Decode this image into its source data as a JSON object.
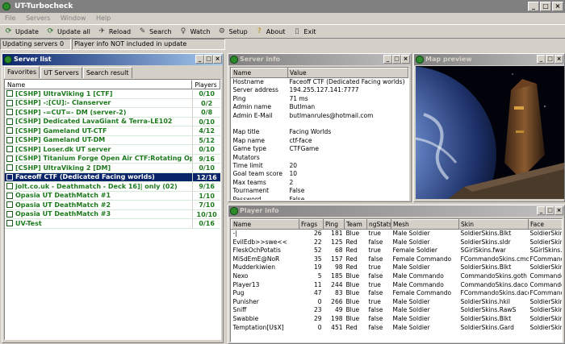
{
  "window": {
    "title": "UT-Turbocheck"
  },
  "menu": [
    "File",
    "Servers",
    "Window",
    "Help"
  ],
  "toolbar": [
    {
      "label": "Update",
      "icon": "update-icon"
    },
    {
      "label": "Update all",
      "icon": "update-all-icon"
    },
    {
      "label": "Reload",
      "icon": "reload-icon"
    },
    {
      "label": "Search",
      "icon": "search-icon"
    },
    {
      "label": "Watch",
      "icon": "watch-icon"
    },
    {
      "label": "Setup",
      "icon": "setup-icon"
    },
    {
      "label": "About",
      "icon": "about-icon"
    },
    {
      "label": "Exit",
      "icon": "exit-icon"
    }
  ],
  "status": {
    "updating": "Updating servers 0",
    "info": "Player info NOT included in update"
  },
  "server_list": {
    "title": "Server list",
    "tabs": [
      "Favorites",
      "UT Servers",
      "Search result"
    ],
    "columns": [
      "Name",
      "Players"
    ],
    "rows": [
      {
        "name": "[CSHP] UltraViking 1 [CTF]",
        "players": "0/10"
      },
      {
        "name": "[CSHP] -:[CU]:- Clanserver",
        "players": "0/2"
      },
      {
        "name": "[CSHP] -=CUT=- DM  (server-2)",
        "players": "0/8"
      },
      {
        "name": "[CSHP] Dedicated LavaGiant & Terra-LE102",
        "players": "0/10"
      },
      {
        "name": "[CSHP] Gameland UT-CTF",
        "players": "4/12"
      },
      {
        "name": "[CSHP] Gameland UT-DM",
        "players": "5/12"
      },
      {
        "name": "[CSHP] Loser.dk UT server",
        "players": "0/10"
      },
      {
        "name": "[CSHP] Titanium Forge Open Air CTF:Rotating Op...",
        "players": "9/16"
      },
      {
        "name": "[CSHP] UltraViking 2 [DM]",
        "players": "0/10"
      },
      {
        "name": "Faceoff CTF (Dedicated Facing worlds)",
        "players": "12/16",
        "selected": true
      },
      {
        "name": "jolt.co.uk - Deathmatch - Deck 16]| only (02)",
        "players": "9/16"
      },
      {
        "name": "Opasia UT DeathMatch #1",
        "players": "1/10"
      },
      {
        "name": "Opasia UT DeathMatch #2",
        "players": "7/10"
      },
      {
        "name": "Opasia UT DeathMatch #3",
        "players": "10/10"
      },
      {
        "name": "UV-Test",
        "players": "0/16"
      }
    ]
  },
  "server_info": {
    "title": "Server info",
    "columns": [
      "Name",
      "Value"
    ],
    "rows": [
      {
        "k": "Hostname",
        "v": "Faceoff CTF (Dedicated Facing worlds)"
      },
      {
        "k": "Server address",
        "v": "194.255.127.141:7777"
      },
      {
        "k": "Ping",
        "v": "71 ms"
      },
      {
        "k": "Admin name",
        "v": "Butlman"
      },
      {
        "k": "Admin E-Mail",
        "v": "butlmanrules@hotmail.com"
      },
      {
        "k": "",
        "v": ""
      },
      {
        "k": "Map title",
        "v": "Facing Worlds"
      },
      {
        "k": "Map name",
        "v": "ctf-face"
      },
      {
        "k": "Game type",
        "v": "CTFGame"
      },
      {
        "k": "Mutators",
        "v": ""
      },
      {
        "k": "Time limit",
        "v": "20"
      },
      {
        "k": "Goal team score",
        "v": "10"
      },
      {
        "k": "Max teams",
        "v": "2"
      },
      {
        "k": "Tournament",
        "v": "False"
      },
      {
        "k": "Password",
        "v": "False"
      }
    ]
  },
  "map_preview": {
    "title": "Map preview"
  },
  "player_info": {
    "title": "Player info",
    "columns": [
      "Name",
      "Frags",
      "Ping",
      "Team",
      "ngStats",
      "Mesh",
      "Skin",
      "Face"
    ],
    "rows": [
      [
        "-|",
        "26",
        "181",
        "Blue",
        "true",
        "Male Soldier",
        "SoldierSkins.Blkt",
        "SoldierSkins"
      ],
      [
        "EvilEdb>>swe<<",
        "22",
        "125",
        "Red",
        "false",
        "Male Soldier",
        "SoldierSkins.sldr",
        "SoldierSkins"
      ],
      [
        "FleskOchPotatis",
        "52",
        "68",
        "Red",
        "true",
        "Female Soldier",
        "SGirlSkins.fwar",
        "SGirlSkins.I"
      ],
      [
        "MiSdEmE@NoR",
        "35",
        "157",
        "Red",
        "false",
        "Female Commando",
        "FCommandoSkins.cmdo",
        "FCommandoS"
      ],
      [
        "Mudderkiwien",
        "19",
        "98",
        "Red",
        "true",
        "Male Soldier",
        "SoldierSkins.Blkt",
        "SoldierSkins"
      ],
      [
        "Nexo",
        "5",
        "185",
        "Blue",
        "false",
        "Male Commando",
        "CommandoSkins.goth",
        "CommandoS"
      ],
      [
        "Player13",
        "11",
        "244",
        "Blue",
        "true",
        "Male Commando",
        "CommandoSkins.daco",
        "CommandoS"
      ],
      [
        "Pug",
        "47",
        "83",
        "Blue",
        "false",
        "Female Commando",
        "FCommandoSkins.daco",
        "FCommandoS"
      ],
      [
        "Punisher",
        "0",
        "266",
        "Blue",
        "true",
        "Male Soldier",
        "SoldierSkins.hkil",
        "SoldierSkins"
      ],
      [
        "Sniff",
        "23",
        "49",
        "Blue",
        "false",
        "Male Soldier",
        "SoldierSkins.RawS",
        "SoldierSkins"
      ],
      [
        "Swabbie",
        "29",
        "198",
        "Blue",
        "false",
        "Male Soldier",
        "SoldierSkins.Blkt",
        "SoldierSkins"
      ],
      [
        "Temptation[U$X]",
        "0",
        "451",
        "Red",
        "false",
        "Male Soldier",
        "SoldierSkins.Gard",
        "SoldierSkins"
      ]
    ]
  }
}
